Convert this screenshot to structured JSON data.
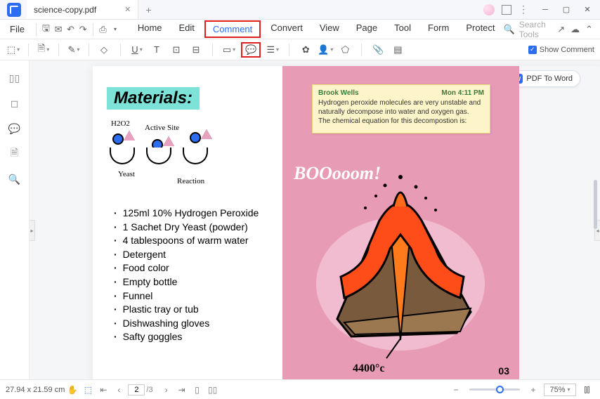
{
  "titlebar": {
    "tab_title": "science-copy.pdf"
  },
  "menu": {
    "file": "File",
    "tabs": [
      "Home",
      "Edit",
      "Comment",
      "Convert",
      "View",
      "Page",
      "Tool",
      "Form",
      "Protect"
    ],
    "active_tab_index": 2,
    "search_placeholder": "Search Tools"
  },
  "toolbar": {
    "show_comment": "Show Comment"
  },
  "pdf_to_word": "PDF To Word",
  "page_left": {
    "title": "Materials:",
    "diagram": {
      "h2o2": "H2O2",
      "active_site": "Active Site",
      "yeast": "Yeast",
      "reaction": "Reaction"
    },
    "items": [
      "125ml 10% Hydrogen Peroxide",
      "1 Sachet Dry Yeast (powder)",
      "4 tablespoons of warm water",
      "Detergent",
      "Food color",
      "Empty bottle",
      "Funnel",
      "Plastic tray or tub",
      "Dishwashing gloves",
      "Safty goggles"
    ]
  },
  "page_right": {
    "boom": "BOOooom!",
    "temperature": "4400°c",
    "page_number": "03"
  },
  "sticky": {
    "author": "Brook Wells",
    "time": "Mon 4:11 PM",
    "line1": "Hydrogen peroxide molecules are very unstable and naturally decompose into water and oxygen gas.",
    "line2": "The chemical equation for this decompostion is:"
  },
  "statusbar": {
    "dimensions": "27.94 x 21.59 cm",
    "page_current": "2",
    "page_total": "/3",
    "zoom": "75%"
  }
}
